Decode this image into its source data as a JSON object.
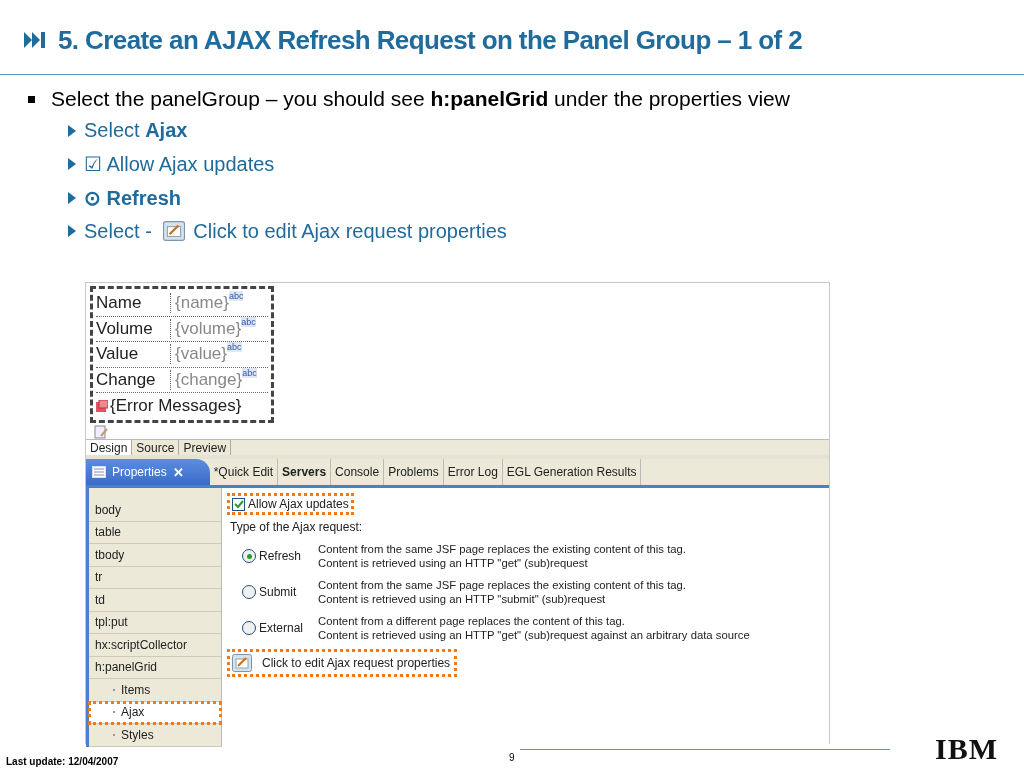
{
  "title": "5. Create an AJAX Refresh Request on the Panel Group – 1 of 2",
  "bullet": "Select the panelGroup – you should see **h:panelGrid** under the properties view",
  "sub_bullets": [
    {
      "kind": "text",
      "text": "Select **Ajax**",
      "bold": false
    },
    {
      "kind": "text",
      "text": "☑ Allow Ajax updates",
      "bold": false
    },
    {
      "kind": "text",
      "text": "⊙ Refresh",
      "bold": true
    },
    {
      "kind": "with_icon",
      "before": "Select - ",
      "after": "Click to edit Ajax request properties",
      "bold": false
    }
  ],
  "design_view": {
    "rows": [
      {
        "label": "Name",
        "value": "{name}",
        "badge": "abc"
      },
      {
        "label": "Volume",
        "value": "{volume}",
        "badge": "abc"
      },
      {
        "label": "Value",
        "value": "{value}",
        "badge": "abc"
      },
      {
        "label": "Change",
        "value": "{change}",
        "badge": "abc"
      }
    ],
    "error_messages": "{Error Messages}",
    "tabs": [
      {
        "label": "Design",
        "selected": true
      },
      {
        "label": "Source",
        "selected": false
      },
      {
        "label": "Preview",
        "selected": false
      }
    ]
  },
  "properties": {
    "tabs": [
      {
        "label": "Properties",
        "selected": true,
        "close": "✕"
      },
      {
        "label": "*Quick Edit",
        "selected": false
      },
      {
        "label": "Servers",
        "selected": false,
        "bold": true
      },
      {
        "label": "Console",
        "selected": false
      },
      {
        "label": "Problems",
        "selected": false
      },
      {
        "label": "Error Log",
        "selected": false
      },
      {
        "label": "EGL Generation Results",
        "selected": false
      }
    ],
    "tree": [
      {
        "label": "body",
        "selected": false
      },
      {
        "label": "table",
        "selected": false
      },
      {
        "label": "tbody",
        "selected": false
      },
      {
        "label": "tr",
        "selected": false
      },
      {
        "label": "td",
        "selected": false
      },
      {
        "label": "tpl:put",
        "selected": false
      },
      {
        "label": "hx:scriptCollector",
        "selected": false
      },
      {
        "label": "h:panelGrid",
        "selected": false,
        "children": [
          {
            "label": "Items",
            "selected": false
          },
          {
            "label": "Ajax",
            "selected": true
          },
          {
            "label": "Styles",
            "selected": false
          }
        ]
      }
    ],
    "allow_ajax": {
      "label": "Allow Ajax updates",
      "checked": true,
      "highlighted": true
    },
    "type_label": "Type of the Ajax request:",
    "request_types": [
      {
        "label": "Refresh",
        "selected": true,
        "lines": [
          "Content from the same JSF page replaces the existing content of this tag.",
          "Content is retrieved using an HTTP \"get\" (sub)request"
        ]
      },
      {
        "label": "Submit",
        "selected": false,
        "lines": [
          "Content from the same JSF page replaces the existing content of this tag.",
          "Content is retrieved using an HTTP \"submit\" (sub)request"
        ]
      },
      {
        "label": "External",
        "selected": false,
        "lines": [
          "Content from a different page replaces the content of this tag.",
          "Content is retrieved using an HTTP \"get\" (sub)request against an arbitrary data source"
        ]
      }
    ],
    "edit_link": {
      "label": "Click to edit Ajax request properties",
      "highlighted": true
    }
  },
  "footer": {
    "last_update": "Last update: 12/04/2007",
    "page": "9",
    "logo": "IBM"
  }
}
